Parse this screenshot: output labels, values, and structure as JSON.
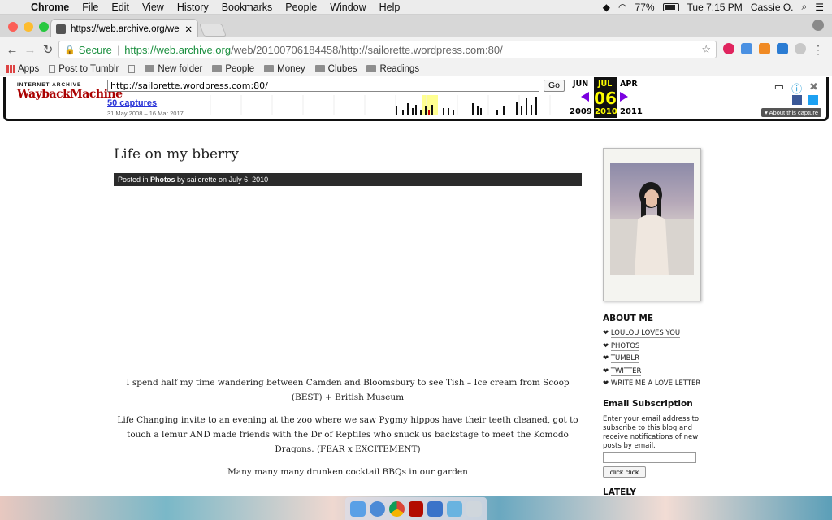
{
  "menubar": {
    "app": "Chrome",
    "items": [
      "File",
      "Edit",
      "View",
      "History",
      "Bookmarks",
      "People",
      "Window",
      "Help"
    ],
    "battery": "77%",
    "clock": "Tue 7:15 PM",
    "user": "Cassie O."
  },
  "tab": {
    "title": "https://web.archive.org/web/20"
  },
  "toolbar": {
    "secure_label": "Secure",
    "url_scheme_host": "https://web.archive.org",
    "url_path": "/web/20100706184458/http://sailorette.wordpress.com:80/"
  },
  "bookmarks": {
    "apps": "Apps",
    "items": [
      "Post to Tumblr",
      "New folder",
      "People",
      "Money",
      "Clubes",
      "Readings"
    ]
  },
  "wayback": {
    "logo_top": "INTERNET ARCHIVE",
    "logo_main": "WaybackMachine",
    "url_value": "http://sailorette.wordpress.com:80/",
    "go_label": "Go",
    "captures": "50 captures",
    "date_range": "31 May 2008 – 16 Mar 2017",
    "prev_month": "JUN",
    "cur_month": "JUL",
    "next_month": "APR",
    "cur_day": "06",
    "prev_year": "2009",
    "cur_year": "2010",
    "next_year": "2011",
    "about": "▾ About this capture"
  },
  "post": {
    "title": "Life on my bberry",
    "meta_prefix": "Posted in ",
    "meta_category": "Photos",
    "meta_suffix": " by sailorette on July 6, 2010",
    "paragraphs": [
      "I spend half my time wandering between Camden and Bloomsbury to see Tish – Ice cream from Scoop (BEST) + British Museum",
      "Life Changing invite to an evening at the zoo where we saw Pygmy hippos have their teeth cleaned, got to touch a lemur AND made friends with the Dr of Reptiles who snuck us backstage to meet the Komodo Dragons. (FEAR x EXCITEMENT)",
      "Many many many drunken cocktail BBQs in our garden"
    ]
  },
  "sidebar": {
    "about_heading": "ABOUT ME",
    "links": [
      "LOULOU LOVES YOU",
      "PHOTOS",
      "TUMBLR",
      "TWITTER",
      "WRITE ME A LOVE LETTER"
    ],
    "bullet": "❤",
    "email_heading": "Email Subscription",
    "email_text": "Enter your email address to subscribe to this blog and receive notifications of new posts by email.",
    "email_placeholder": "",
    "button_label": "click click",
    "lately_heading": "LATELY"
  },
  "colors": {
    "accent_green": "#1a8f3e",
    "wayback_red": "#a00000",
    "link_blue": "#2a34d8",
    "calendar_yellow": "#ffff00",
    "arrow_purple": "#7a00e0"
  }
}
